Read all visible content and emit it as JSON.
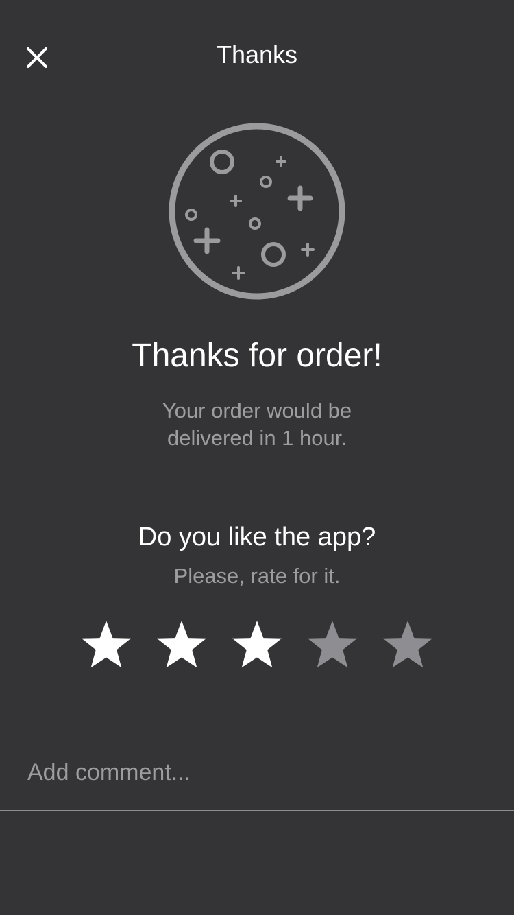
{
  "nav": {
    "title": "Thanks"
  },
  "illustration": {
    "icon": "celebration-plate-icon"
  },
  "confirmation": {
    "heading": "Thanks for order!",
    "message": "Your order would be delivered in 1 hour."
  },
  "rating": {
    "question": "Do you like the app?",
    "prompt": "Please, rate for it.",
    "max": 5,
    "value": 3,
    "active_color": "#ffffff",
    "inactive_color": "#8e8e92"
  },
  "comment": {
    "placeholder": "Add comment..."
  },
  "colors": {
    "background": "#343436",
    "secondary_text": "#9d9da1",
    "illustration": "#9b9b9e"
  }
}
